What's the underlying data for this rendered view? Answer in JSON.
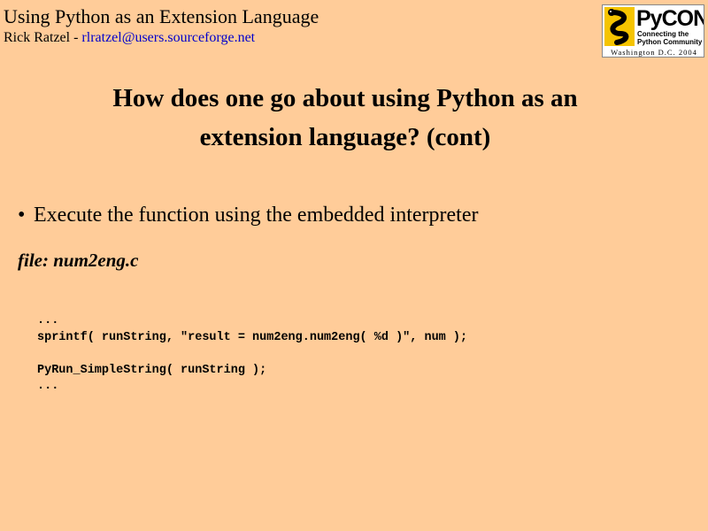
{
  "header": {
    "title": "Using Python as an Extension Language",
    "author": "Rick Ratzel - ",
    "email": "rlratzel@users.sourceforge.net"
  },
  "logo": {
    "name": "PyCON",
    "tagline_1": "Connecting the",
    "tagline_2": "Python Community",
    "place": "Washington D.C. 2004",
    "accent_color": "#f5c400"
  },
  "slide": {
    "title_line1": "How does one go about using Python as an",
    "title_line2": "extension language? (cont)",
    "bullet_symbol": "•",
    "bullet": "Execute the function using the embedded interpreter",
    "file_label": "file: num2eng.c",
    "code_lines": [
      "...",
      "sprintf( runString, \"result = num2eng.num2eng( %d )\", num );",
      "",
      "PyRun_SimpleString( runString );",
      "..."
    ]
  },
  "colors": {
    "background": "#ffcc99",
    "link": "#0000cc"
  }
}
